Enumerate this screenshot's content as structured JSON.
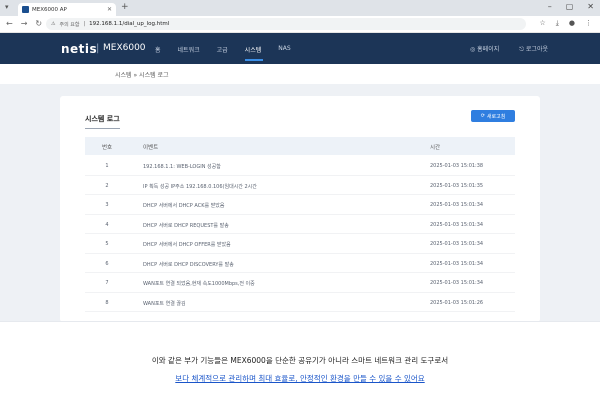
{
  "browser": {
    "tab_title": "MEX6000 AP",
    "security_label": "주의 요함",
    "url": "192.168.1.1/dial_up_log.html",
    "icons": [
      "tab-menu-icon",
      "close-icon",
      "new-tab-icon",
      "back-icon",
      "forward-icon",
      "reload-icon",
      "star-icon",
      "download-icon",
      "profile-icon",
      "menu-icon"
    ]
  },
  "router": {
    "logo": "netis",
    "model": "MEX6000",
    "menu": [
      "홈",
      "네트워크",
      "고급",
      "시스템",
      "NAS"
    ],
    "active_menu": "시스템",
    "homepage_label": "홈페이지",
    "logout_label": "로그아웃",
    "breadcrumb": "시스템 » 시스템 로그"
  },
  "log": {
    "title": "시스템 로그",
    "refresh_label": "새로고침",
    "headers": {
      "no": "번호",
      "event": "이벤트",
      "time": "시간"
    },
    "rows": [
      {
        "no": "1",
        "event": "192.168.1.1: WEB-LOGIN 성공함",
        "time": "2025-01-03 15:01:38"
      },
      {
        "no": "2",
        "event": "IP 획득 성공 IP주소 192.168.0.106(임대시간 2시간",
        "time": "2025-01-03 15:01:35"
      },
      {
        "no": "3",
        "event": "DHCP 서버에서 DHCP ACK를 받았음",
        "time": "2025-01-03 15:01:34"
      },
      {
        "no": "4",
        "event": "DHCP 서버로 DHCP REQUEST를 발송",
        "time": "2025-01-03 15:01:34"
      },
      {
        "no": "5",
        "event": "DHCP 서버에서 DHCP OFFER를 받았음",
        "time": "2025-01-03 15:01:34"
      },
      {
        "no": "6",
        "event": "DHCP 서버로 DHCP DISCOVERY를 발송",
        "time": "2025-01-03 15:01:34"
      },
      {
        "no": "7",
        "event": "WAN포트 연결 되었음,현재 속도1000Mbps,전 이중",
        "time": "2025-01-03 15:01:34"
      },
      {
        "no": "8",
        "event": "WAN포트 연결 끊김",
        "time": "2025-01-03 15:01:26"
      }
    ]
  },
  "caption": {
    "line1": "이와 같은 부가 기능들은 MEX6000을 단순한 공유기가 아니라 스마트 네트워크 관리 도구로서",
    "line2": "보다 체계적으로 관리하며 최대 효율로, 안정적인 환경을 만들 수 있을 수 있어요"
  },
  "colors": {
    "navbar": "#1c3557",
    "accent": "#2f7ee0",
    "link": "#1a55c9"
  }
}
